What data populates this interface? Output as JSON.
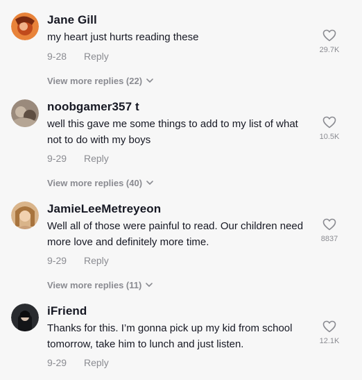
{
  "comments": [
    {
      "username": "Jane Gill",
      "text": "my heart just hurts reading these",
      "date": "9-28",
      "reply_label": "Reply",
      "like_count": "29.7K",
      "like_icon": "heart-outline-icon",
      "view_replies": "View more replies (22)"
    },
    {
      "username": "noobgamer357 t",
      "text": "well this gave me some things to add to my list of what not to do with my boys",
      "date": "9-29",
      "reply_label": "Reply",
      "like_count": "10.5K",
      "like_icon": "heart-outline-icon",
      "view_replies": "View more replies (40)"
    },
    {
      "username": "JamieLeeMetreyeon",
      "text": "Well all of those were painful to read. Our children need more love and definitely more time.",
      "date": "9-29",
      "reply_label": "Reply",
      "like_count": "8837",
      "like_icon": "heart-outline-icon",
      "view_replies": "View more replies (11)"
    },
    {
      "username": "iFriend",
      "text": "Thanks for this. I’m gonna pick up my kid from school tomorrow, take him to lunch and just listen.",
      "date": "9-29",
      "reply_label": "Reply",
      "like_count": "12.1K",
      "like_icon": "heart-outline-icon"
    }
  ],
  "colors": {
    "background": "#f7f7f7",
    "primary_text": "#161823",
    "secondary_text": "#8a8b91"
  }
}
